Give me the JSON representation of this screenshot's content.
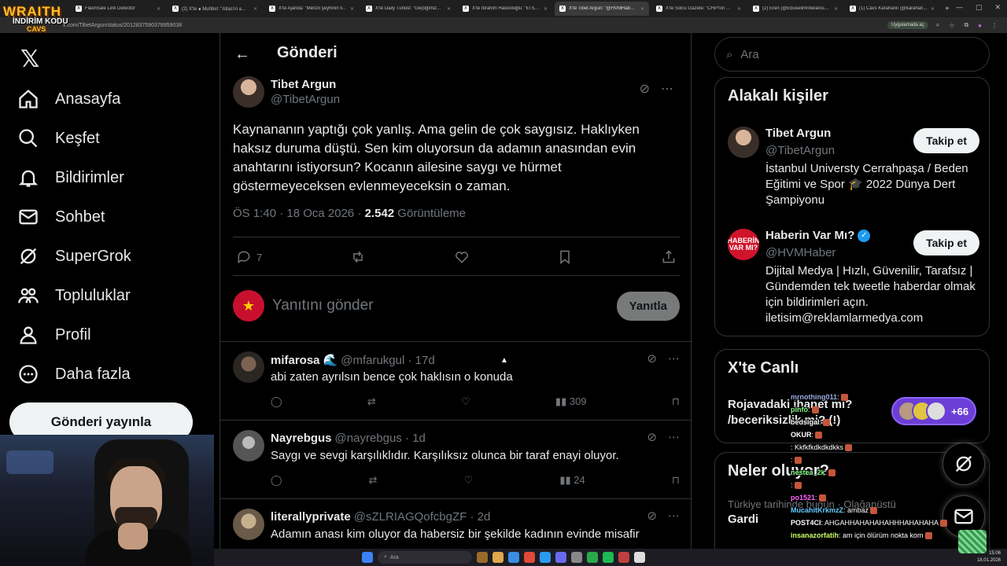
{
  "browser": {
    "tabs": [
      {
        "label": "FlashSale Link Detector",
        "active": false
      },
      {
        "label": "(2) X'te ∎ Muhbiri: \"Atlas'ın a...",
        "active": false
      },
      {
        "label": "X'te Ajanda: \"Menzil şeyhinin li...",
        "active": false
      },
      {
        "label": "X'te Daily Türkist: \"Geçtiğimiz...",
        "active": false
      },
      {
        "label": "X'te İbrahim Haskoloğlu: \"El Sa...",
        "active": false
      },
      {
        "label": "X'te Tibet Argun: \"@HVMHaber...",
        "active": true
      },
      {
        "label": "X'te Solcu Gazete: \"CHP'nin Ha...",
        "active": false
      },
      {
        "label": "(2) Eren (@Ebuselimnbelarus) /...",
        "active": false
      },
      {
        "label": "(1) Cavs Karahanlı (@karahan...",
        "active": false
      }
    ],
    "url": "x.com/TibetArgun/status/2012837590378959038",
    "app_button": "Uygulamada aç"
  },
  "overlay_logo": {
    "line1": "WRAITH",
    "line2": "İNDİRİM KODU",
    "line3": "CAVS"
  },
  "nav": {
    "items": [
      {
        "label": "Anasayfa",
        "icon": "home-icon"
      },
      {
        "label": "Keşfet",
        "icon": "search-icon"
      },
      {
        "label": "Bildirimler",
        "icon": "bell-icon"
      },
      {
        "label": "Sohbet",
        "icon": "mail-icon"
      },
      {
        "label": "SuperGrok",
        "icon": "grok-icon"
      },
      {
        "label": "Topluluklar",
        "icon": "communities-icon"
      },
      {
        "label": "Profil",
        "icon": "profile-icon"
      },
      {
        "label": "Daha fazla",
        "icon": "more-icon"
      }
    ],
    "post_button": "Gönderi yayınla"
  },
  "header": {
    "title": "Gönderi"
  },
  "main_post": {
    "name": "Tibet Argun",
    "handle": "@TibetArgun",
    "text": "Kaynananın yaptığı çok yanlış. Ama gelin de çok saygısız. Haklıyken haksız duruma düştü. Sen kim oluyorsun da adamın anasından evin anahtarını istiyorsun? Kocanın ailesine saygı ve hürmet göstermeyeceksen evlenmeyeceksin o zaman.",
    "time": "ÖS 1:40 · 18 Oca 2026 · ",
    "views": "2.542",
    "views_label": " Görüntüleme",
    "replies": "7"
  },
  "reply_box": {
    "placeholder": "Yanıtını gönder",
    "button": "Yanıtla"
  },
  "replies": [
    {
      "name": "mifarosa",
      "emoji": "🌊",
      "meta": "@mfarukgul · 17d",
      "text": "abi zaten ayrılsın bence çok haklısın o konuda",
      "views": "309"
    },
    {
      "name": "Nayrebgus",
      "emoji": "",
      "meta": "@nayrebgus · 1d",
      "text": "Saygı ve sevgi karşılıklıdır. Karşılıksız olunca bir taraf enayi oluyor.",
      "views": "24"
    },
    {
      "name": "literallyprivate",
      "emoji": "",
      "meta": "@sZLRIAGQofcbgZF · 2d",
      "text": "Adamın anası kim oluyor da habersiz bir şekilde kadının evinde misafir",
      "views": ""
    }
  ],
  "search": {
    "placeholder": "Ara"
  },
  "related": {
    "title": "Alakalı kişiler",
    "people": [
      {
        "name": "Tibet Argun",
        "handle": "@TibetArgun",
        "bio": "İstanbul Universty Cerrahpaşa / Beden Eğitimi ve Spor 🎓 2022 Dünya Dert Şampiyonu",
        "follow": "Takip et",
        "verified": false
      },
      {
        "name": "Haberin Var Mı?",
        "handle": "@HVMHaber",
        "bio": "Dijital Medya | Hızlı, Güvenilir, Tarafsız | Gündemden tek tweetle haberdar olmak için bildirimleri açın. iletisim@reklamlarmedya.com",
        "follow": "Takip et",
        "verified": true,
        "avatar_text": "HABERİN VAR MI?"
      }
    ]
  },
  "live": {
    "title": "X'te Canlı",
    "topic": "Rojavadaki ihanet mi? /beceriksizlik mi? (!)",
    "count": "+66"
  },
  "happening": {
    "title": "Neler oluyor?",
    "subtitle": "Türkiye tarihinde bugün · Olağanüstü",
    "item": "Gardi"
  },
  "chat": [
    {
      "user": "mrnothing011",
      "msg": ":",
      "color": "#9ad"
    },
    {
      "user": "pinfo",
      "msg": ":",
      "color": "#8f8"
    },
    {
      "user": "bedsigal",
      "msg": ":",
      "color": "#fff"
    },
    {
      "user": "OKUR",
      "msg": ":",
      "color": "#fff"
    },
    {
      "user": "",
      "msg": ": Kkfkfkdkdkdkks",
      "color": "#f66"
    },
    {
      "user": "",
      "msg": ":",
      "color": "#f66"
    },
    {
      "user": "nestea_2k",
      "msg": ":",
      "color": "#8f8"
    },
    {
      "user": "",
      "msg": ":",
      "color": "#88f"
    },
    {
      "user": "po1521",
      "msg": ":",
      "color": "#f6f"
    },
    {
      "user": "MucahitKrkmzZ",
      "msg": ": ambaz",
      "color": "#6cf"
    },
    {
      "user": "POST4CI",
      "msg": ": AHGAHHAHAHAHAHHHAHAHAHA",
      "color": "#fff"
    },
    {
      "user": "insanazorfatih",
      "msg": ": am için ölürüm nokta kom",
      "color": "#cf6"
    }
  ],
  "taskbar": {
    "search": "Ara",
    "time": "15:06",
    "date": "18.01.2026"
  }
}
